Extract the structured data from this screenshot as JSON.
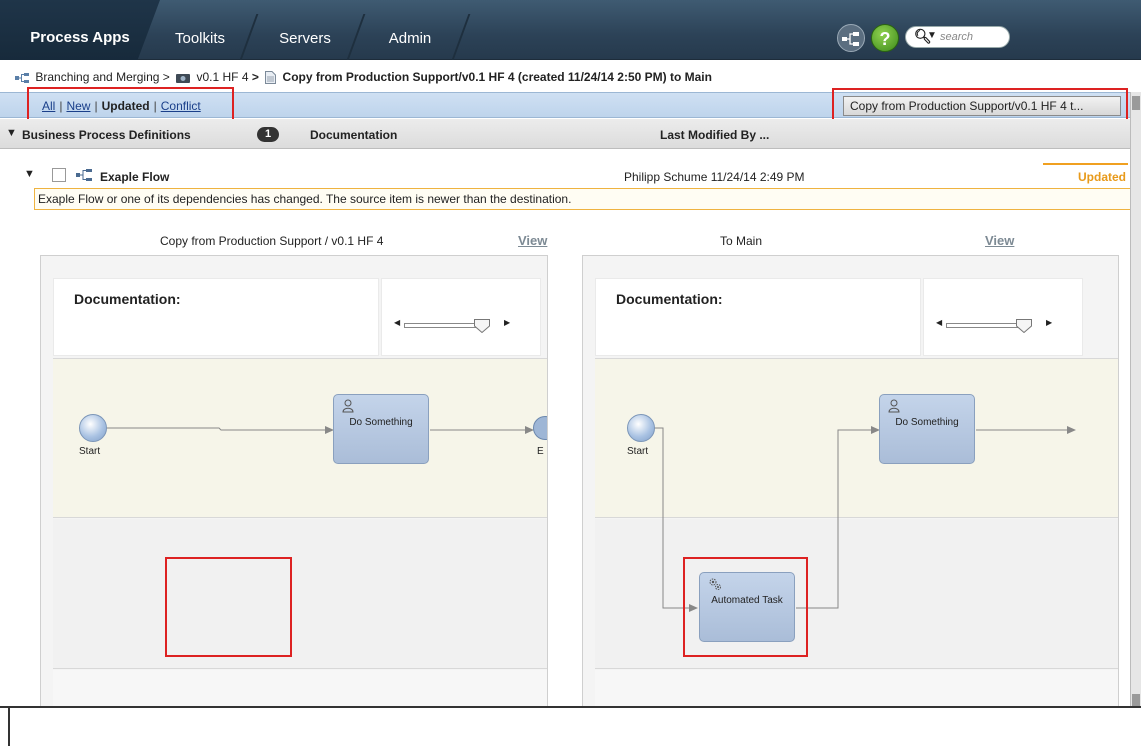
{
  "nav": {
    "tabs": [
      {
        "label": "Process Apps",
        "active": true
      },
      {
        "label": "Toolkits"
      },
      {
        "label": "Servers"
      },
      {
        "label": "Admin"
      }
    ],
    "help_label": "?",
    "search_placeholder": "search"
  },
  "breadcrumb": {
    "item1": "Branching and Merging",
    "sep": ">",
    "item2": "v0.1 HF 4",
    "item3": "Copy from Production Support/v0.1 HF 4 (created 11/24/14 2:50 PM) to Main"
  },
  "filters": {
    "all": "All",
    "new": "New",
    "updated": "Updated",
    "conflict": "Conflict",
    "separator": "|"
  },
  "copy_button": "Copy from Production Support/v0.1 HF 4 t...",
  "columns": {
    "definitions": "Business Process Definitions",
    "count": "1",
    "documentation": "Documentation",
    "last_modified": "Last Modified By ..."
  },
  "item": {
    "name": "Exaple Flow",
    "modified": "Philipp Schume 11/24/14 2:49 PM",
    "status": "Updated",
    "message": "Exaple Flow or one of its dependencies has changed. The source item is newer than the destination."
  },
  "left_panel": {
    "title": "Copy from Production Support / v0.1 HF 4",
    "view": "View",
    "doc_label": "Documentation:",
    "start_label": "Start",
    "task_label": "Do Something",
    "end_label_partial": "E"
  },
  "right_panel": {
    "title": "To Main",
    "view": "View",
    "doc_label": "Documentation:",
    "start_label": "Start",
    "task_label": "Do Something",
    "auto_task_label": "Automated Task"
  },
  "colors": {
    "nav_bg": "#2c4257",
    "filter_bg": "#c4d8ef",
    "highlight_red": "#dd2222",
    "updated_orange": "#e89a1a",
    "task_blue": "#b4c6e0"
  }
}
